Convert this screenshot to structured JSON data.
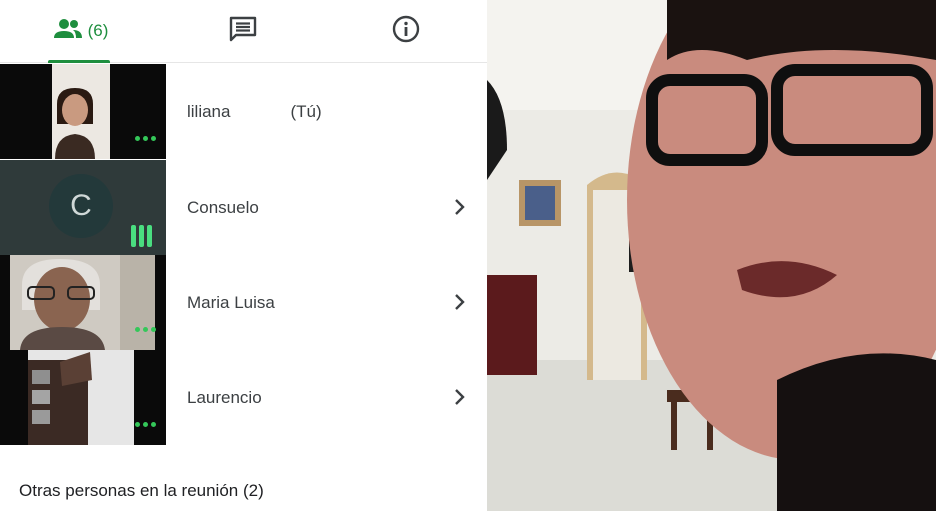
{
  "tabs": {
    "people_count": "(6)",
    "people_icon": "people-icon",
    "chat_icon": "chat-icon",
    "info_icon": "info-icon",
    "accent": "#1e8e3e"
  },
  "participants": [
    {
      "name": "liliana",
      "suffix": "(Tú)"
    },
    {
      "name": "Consuelo",
      "avatar_letter": "C"
    },
    {
      "name": "Maria Luisa"
    },
    {
      "name": "Laurencio"
    }
  ],
  "others_section": {
    "label": "Otras personas en la reunión (2)"
  }
}
